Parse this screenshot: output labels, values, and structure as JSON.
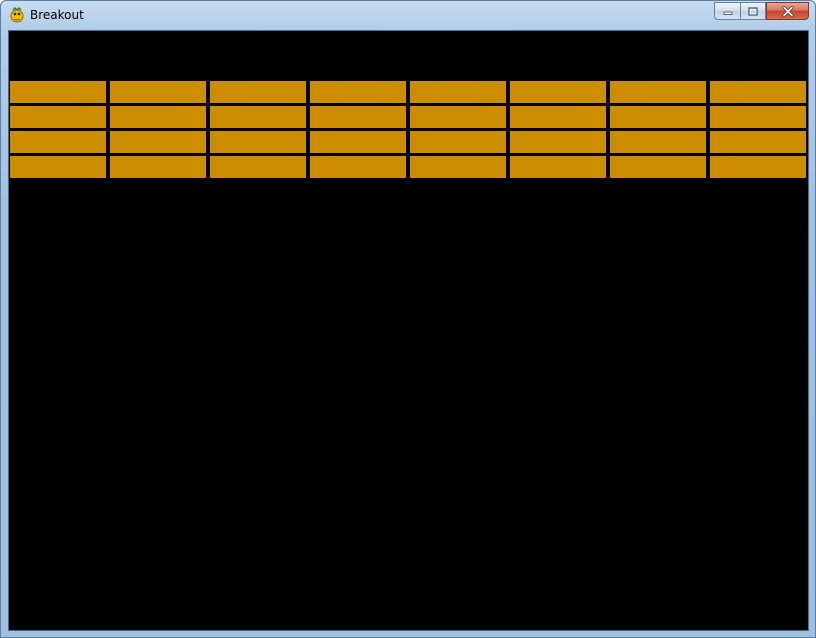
{
  "window": {
    "title": "Breakout",
    "app_icon": "pygame-snake-icon",
    "controls": [
      "minimize-icon",
      "maximize-icon",
      "close-icon"
    ]
  },
  "game": {
    "background_color": "#000000",
    "brick_color": "#cc8e00",
    "brick_rows": 4,
    "brick_columns": 8
  }
}
